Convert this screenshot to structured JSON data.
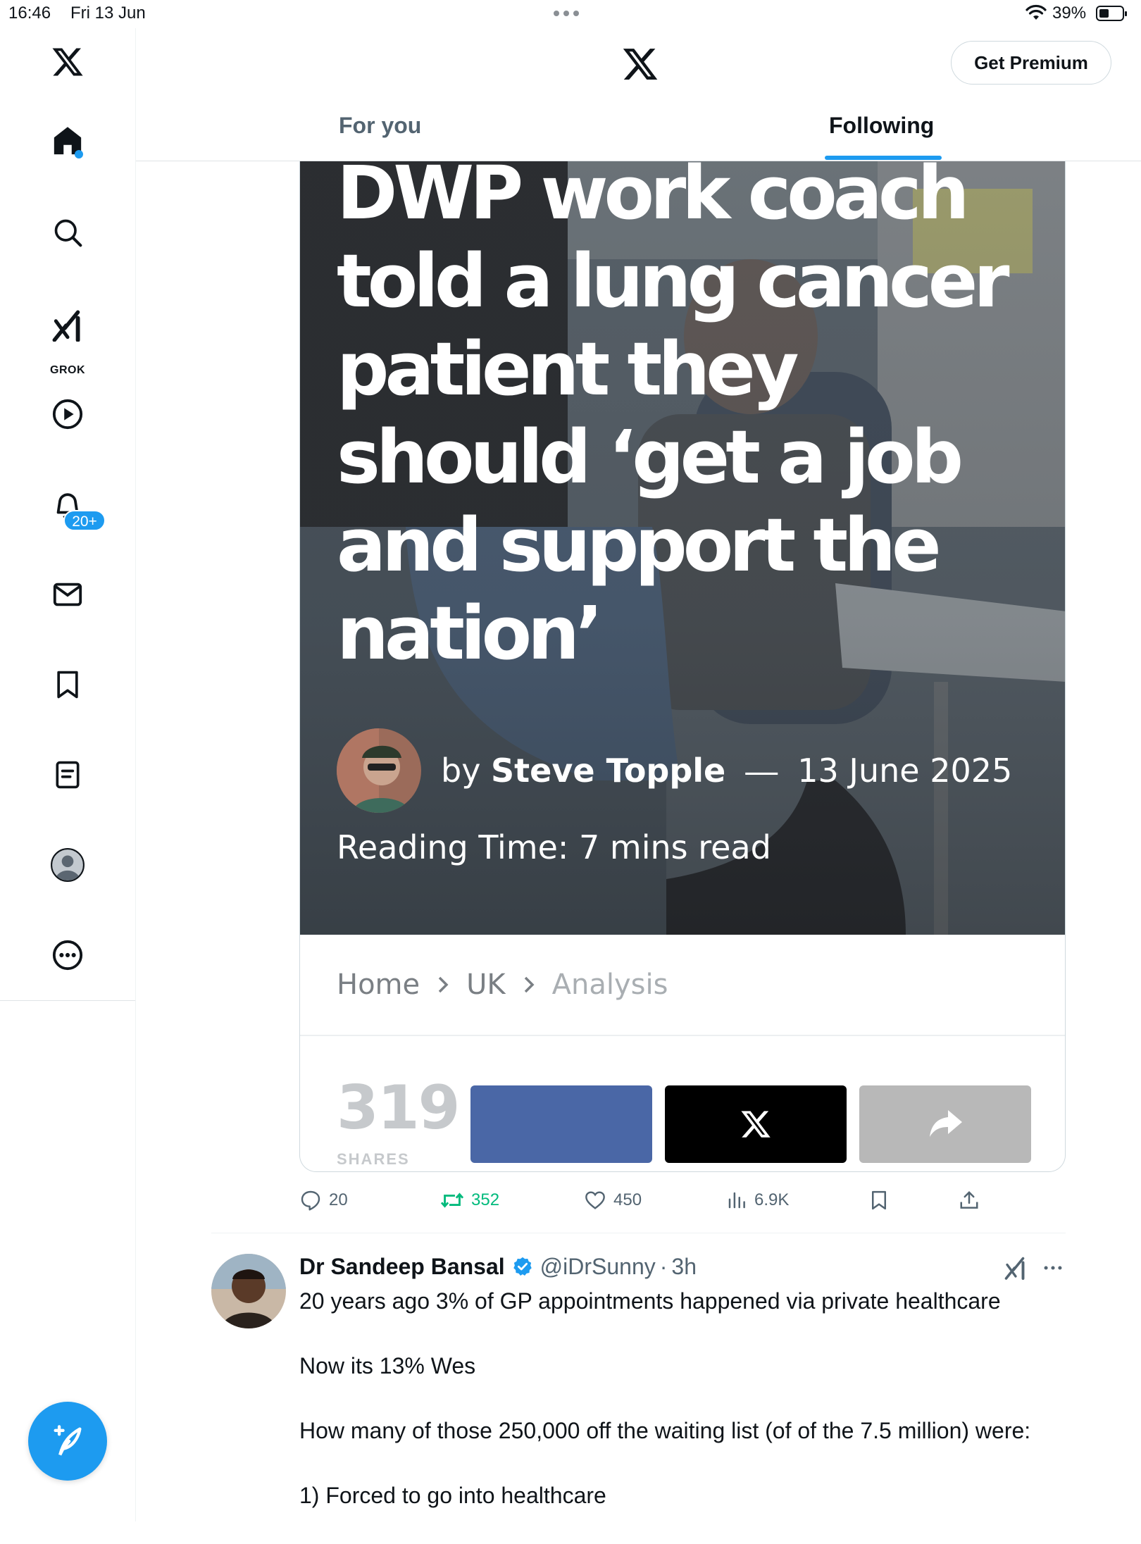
{
  "status_bar": {
    "time": "16:46",
    "date": "Fri 13 Jun",
    "battery": "39%"
  },
  "sidebar": {
    "grok_label": "GROK",
    "notifications_badge": "20+"
  },
  "header": {
    "premium_button": "Get Premium",
    "tabs": [
      {
        "label": "For you",
        "active": false
      },
      {
        "label": "Following",
        "active": true
      }
    ]
  },
  "article": {
    "headline": "DWP work coach told a lung cancer patient they should ‘get a job and support the nation’",
    "byline_prefix": "by",
    "author": "Steve Topple",
    "dash": "—",
    "date": "13 June 2025",
    "reading_time": "Reading Time: 7 mins read",
    "breadcrumb": [
      "Home",
      "UK",
      "Analysis"
    ],
    "share_count": "319",
    "share_count_label": "SHARES"
  },
  "tweet_actions": {
    "replies": "20",
    "reposts": "352",
    "likes": "450",
    "views": "6.9K"
  },
  "tweet2": {
    "name": "Dr Sandeep Bansal",
    "handle": "@iDrSunny",
    "separator": "·",
    "time": "3h",
    "paragraphs": [
      "20 years ago 3% of GP appointments happened via private healthcare",
      "Now its 13% Wes",
      "How many of those 250,000 off the waiting list (of of the 7.5 million) were:",
      "1) Forced to go into healthcare"
    ]
  },
  "colors": {
    "accent": "#1d9bf0",
    "repost_green": "#00ba7c",
    "facebook_blue": "#4a67a6",
    "muted_text": "#536471"
  },
  "icons": [
    "x-logo-icon",
    "home-icon",
    "search-icon",
    "grok-icon",
    "video-icon",
    "bell-icon",
    "mail-icon",
    "bookmark-icon",
    "lists-icon",
    "profile-icon",
    "more-icon",
    "compose-icon"
  ]
}
